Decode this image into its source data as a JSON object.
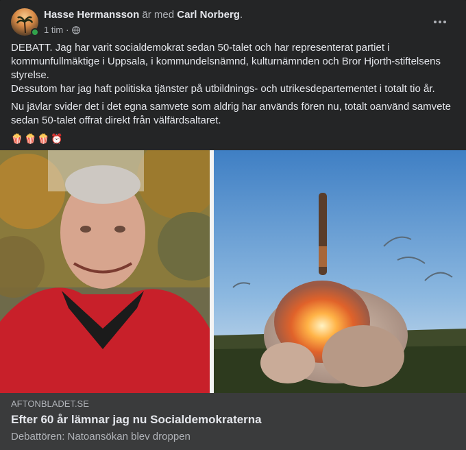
{
  "post": {
    "author": "Hasse Hermansson",
    "with_text": "är med",
    "tagged": "Carl Norberg",
    "tagged_suffix": ".",
    "time": "1 tim",
    "dot": "·",
    "privacy_icon": "globe-icon",
    "paragraphs": [
      "DEBATT. Jag har varit socialdemokrat sedan 50-talet och har representerat partiet i kommunfullmäktige i Uppsala, i kommundelsnämnd, kulturnämnden och Bror Hjorth-stiftelsens styrelse.",
      "Dessutom har jag haft politiska tjänster på utbildnings- och utrikesdepartementet i totalt tio år.",
      "Nu jävlar svider det i det egna samvete som aldrig har används fören nu, totalt oanvänd samvete sedan 50-talet offrat direkt från välfärdsaltaret."
    ],
    "emojis": [
      "🍿",
      "🍿",
      "🍿",
      "⏰"
    ]
  },
  "link": {
    "domain": "AFTONBLADET.SE",
    "title": "Efter 60 år lämnar jag nu Socialdemokraterna",
    "subtitle": "Debattören: Natoansökan blev droppen"
  },
  "colors": {
    "card_bg": "#242526",
    "link_bg": "#3a3b3c",
    "online": "#31a24c",
    "text": "#e4e6eb",
    "muted": "#b0b3b8"
  }
}
